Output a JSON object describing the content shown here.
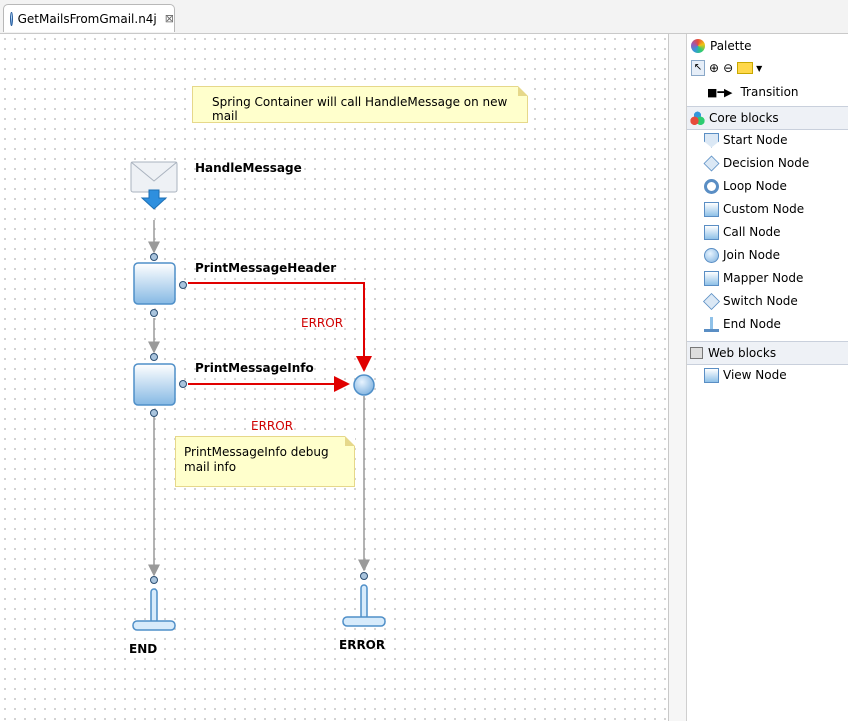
{
  "tab": {
    "title": "GetMailsFromGmail.n4j",
    "close_glyph": "⊠",
    "icon": "globe-icon"
  },
  "notes": {
    "top": "Spring Container will call HandleMessage on new mail",
    "debug": "PrintMessageInfo debug mail info"
  },
  "nodes": {
    "handle": "HandleMessage",
    "header": "PrintMessageHeader",
    "info": "PrintMessageInfo",
    "end": "END",
    "error_end": "ERROR"
  },
  "edges": {
    "error_1": "ERROR",
    "error_2": "ERROR"
  },
  "palette": {
    "title": "Palette",
    "transition": "Transition",
    "core_title": "Core blocks",
    "core_items": [
      "Start Node",
      "Decision Node",
      "Loop Node",
      "Custom Node",
      "Call Node",
      "Join Node",
      "Mapper Node",
      "Switch Node",
      "End Node"
    ],
    "web_title": "Web blocks",
    "web_items": [
      "View Node"
    ]
  },
  "colors": {
    "error": "#d00000",
    "node_blue": "#8fc1e8",
    "note_bg": "#ffffcc"
  }
}
